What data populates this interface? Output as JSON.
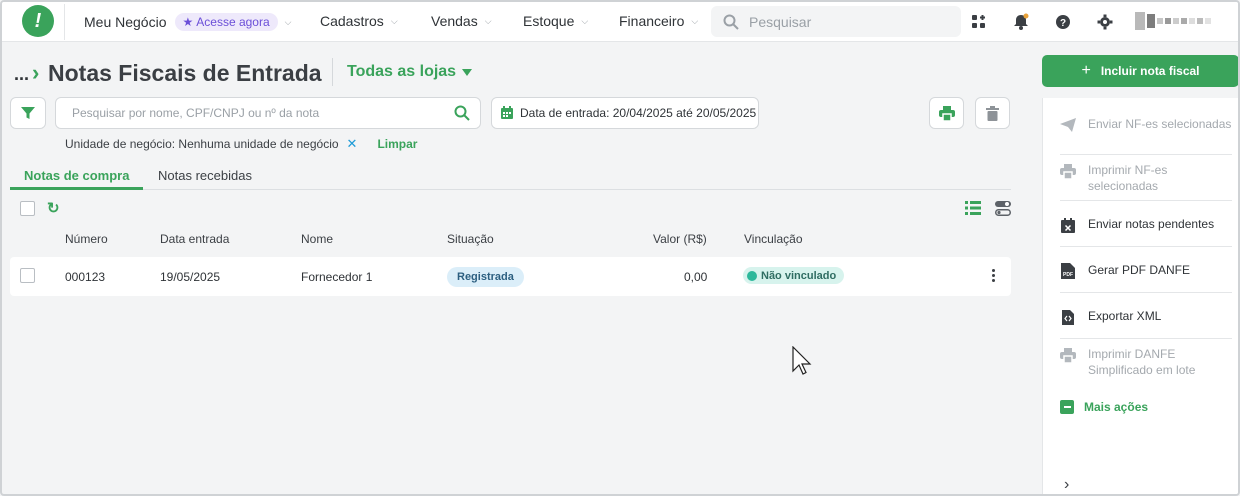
{
  "nav": {
    "business": "Meu Negócio",
    "access_badge": "Acesse agora",
    "items": [
      "Cadastros",
      "Vendas",
      "Estoque",
      "Financeiro"
    ],
    "search_placeholder": "Pesquisar"
  },
  "header": {
    "breadcrumb": "...",
    "title": "Notas Fiscais de Entrada",
    "store": "Todas as lojas",
    "include_button": "Incluir nota fiscal"
  },
  "filters": {
    "search_placeholder": "Pesquisar por nome, CPF/CNPJ ou nº da nota",
    "date_range": "Data de entrada: 20/04/2025 até 20/05/2025",
    "unit_label": "Unidade de negócio: Nenhuma unidade de negócio",
    "clear": "Limpar"
  },
  "tabs": [
    "Notas de compra",
    "Notas recebidas"
  ],
  "table": {
    "columns": [
      "Número",
      "Data entrada",
      "Nome",
      "Situação",
      "Valor (R$)",
      "Vinculação"
    ],
    "rows": [
      {
        "numero": "000123",
        "data": "19/05/2025",
        "nome": "Fornecedor 1",
        "situacao": "Registrada",
        "valor": "0,00",
        "vinculacao": "Não vinculado"
      }
    ]
  },
  "side_actions": [
    {
      "label": "Enviar NF-es selecionadas",
      "icon": "send-icon",
      "enabled": false
    },
    {
      "label": "Imprimir NF-es selecionadas",
      "icon": "printer-icon",
      "enabled": false
    },
    {
      "label": "Enviar notas pendentes",
      "icon": "calendar-x-icon",
      "enabled": true
    },
    {
      "label": "Gerar PDF DANFE",
      "icon": "pdf-icon",
      "enabled": true
    },
    {
      "label": "Exportar XML",
      "icon": "code-file-icon",
      "enabled": true
    },
    {
      "label": "Imprimir DANFE Simplificado em lote",
      "icon": "printer-icon",
      "enabled": false
    }
  ],
  "more_actions": "Mais ações",
  "colors": {
    "brand": "#3aa35b",
    "purple": "#6b4fd8",
    "teal": "#2db89b"
  }
}
